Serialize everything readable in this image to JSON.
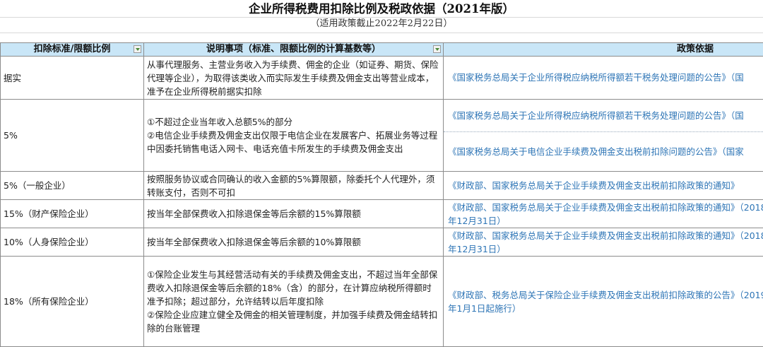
{
  "title": "企业所得税费用扣除比例及税政依据（2021年版）",
  "subtitle": "（适用政策截止2022年2月22日）",
  "headers": {
    "standard": "扣除标准/限额比例",
    "description": "说明事项（标准、限额比例的计算基数等）",
    "basis": "政策依据"
  },
  "rows": [
    {
      "standard": "据实",
      "description": "从事代理服务、主营业务收入为手续费、佣金的企业（如证券、期货、保险代理等企业），为取得该类收入而实际发生手续费及佣金支出等营业成本，准予在企业所得税前据实扣除",
      "basis": [
        "《国家税务总局关于企业所得税应纳税所得额若干税务处理问题的公告》（国"
      ]
    },
    {
      "standard": "5%",
      "description": "①不超过企业当年收入总额5%的部分\n②电信企业手续费及佣金支出仅限于电信企业在发展客户、拓展业务等过程中因委托销售电话入网卡、电话充值卡所发生的手续费及佣金支出",
      "basis": [
        "《国家税务总局关于企业所得税应纳税所得额若干税务处理问题的公告》（国",
        "《国家税务总局关于电信企业手续费及佣金支出税前扣除问题的公告》（国家"
      ]
    },
    {
      "standard": "5%（一般企业）",
      "description": "按照服务协议或合同确认的收入金额的5%算限额，除委托个人代理外，须转账支付，否则不可扣",
      "basis": [
        "《财政部、国家税务总局关于企业手续费及佣金支出税前扣除政策的通知》"
      ]
    },
    {
      "standard": "15%（财产保险企业）",
      "description": "按当年全部保费收入扣除退保金等后余额的15%算限额",
      "basis": [
        "《财政部、国家税务总局关于企业手续费及佣金支出税前扣除政策的通知》（2018年12月31日）"
      ]
    },
    {
      "standard": "10%（人身保险企业）",
      "description": "按当年全部保费收入扣除退保金等后余额的10%算限额",
      "basis": [
        "《财政部、国家税务总局关于企业手续费及佣金支出税前扣除政策的通知》（2018年12月31日）"
      ]
    },
    {
      "standard": "18%（所有保险企业）",
      "description": "①保险企业发生与其经营活动有关的手续费及佣金支出，不超过当年全部保费收入扣除退保金等后余额的18%（含）的部分，在计算应纳税所得额时准予扣除；超过部分，允许结转以后年度扣除\n②保险企业应建立健全及佣金的相关管理制度，并加强手续费及佣金结转扣除的台账管理",
      "basis": [
        "《财政部、税务总局关于保险企业手续费及佣金支出税前扣除政策的公告》（2019年1月1日起施行）"
      ]
    }
  ]
}
